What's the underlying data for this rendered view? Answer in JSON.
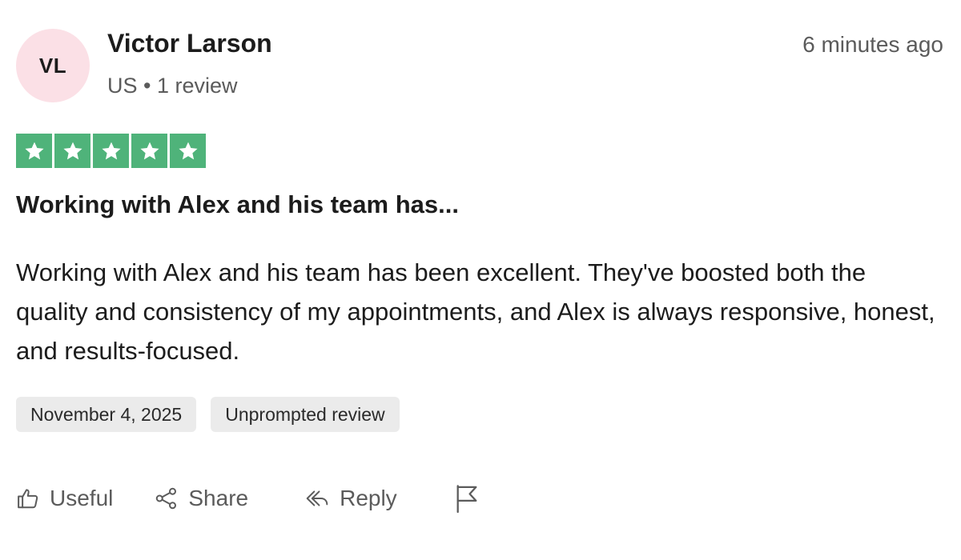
{
  "reviewer": {
    "initials": "VL",
    "name": "Victor Larson",
    "meta": "US • 1 review",
    "avatar_bg": "#fbe0e6"
  },
  "timestamp": "6 minutes ago",
  "rating": {
    "stars": 5,
    "max": 5,
    "star_color": "#4fb37a"
  },
  "review": {
    "title": "Working with Alex and his team has...",
    "body": "Working with Alex and his team has been excellent. They've boosted both the quality and consistency of my appointments, and Alex is always responsive, honest, and results-focused."
  },
  "tags": {
    "date": "November 4, 2025",
    "type": "Unprompted review"
  },
  "actions": {
    "useful": {
      "label": "Useful",
      "icon": "thumbs-up-icon"
    },
    "share": {
      "label": "Share",
      "icon": "share-icon"
    },
    "reply": {
      "label": "Reply",
      "icon": "reply-icon"
    },
    "report": {
      "icon": "flag-icon"
    }
  }
}
